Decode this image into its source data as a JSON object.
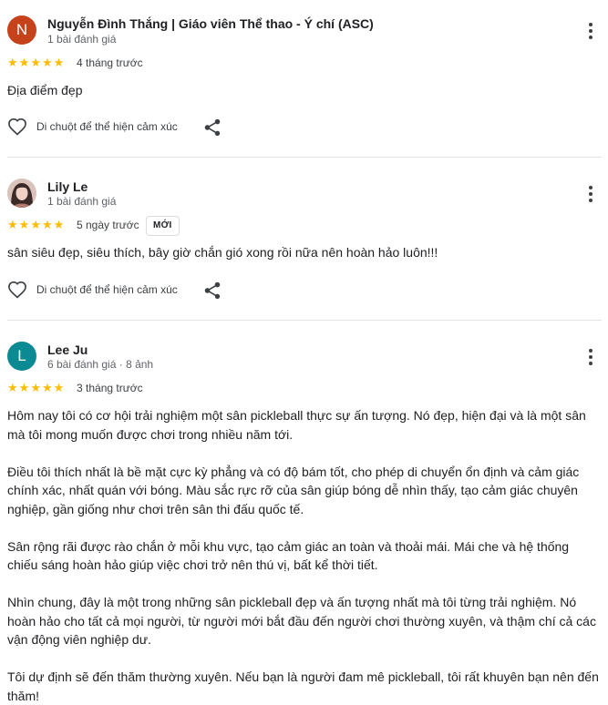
{
  "reviews": [
    {
      "avatar_letter": "N",
      "avatar_color": "#c5421a",
      "name": "Nguyễn Đình Thắng | Giáo viên Thể thao - Ý chí (ASC)",
      "meta": "1 bài đánh giá",
      "rating": 5,
      "time": "4 tháng trước",
      "badge": "",
      "paragraphs": [
        "Địa điểm đẹp"
      ],
      "react_label": "Di chuột để thể hiện cảm xúc"
    },
    {
      "avatar_letter": "",
      "avatar_color": "#6b4f4a",
      "name": "Lily Le",
      "meta": "1 bài đánh giá",
      "rating": 5,
      "time": "5 ngày trước",
      "badge": "MỚI",
      "paragraphs": [
        "sân siêu đẹp, siêu thích, bây giờ chắn gió xong rồi nữa nên hoàn hảo luôn!!!"
      ],
      "react_label": "Di chuột để thể hiện cảm xúc"
    },
    {
      "avatar_letter": "L",
      "avatar_color": "#0b8a94",
      "name": "Lee Ju",
      "meta": "6 bài đánh giá · 8 ảnh",
      "rating": 5,
      "time": "3 tháng trước",
      "badge": "",
      "paragraphs": [
        "Hôm nay tôi có cơ hội trải nghiệm một sân pickleball thực sự ấn tượng. Nó đẹp, hiện đại và là một sân mà tôi mong muốn được chơi trong nhiều năm tới.",
        "Điều tôi thích nhất là bề mặt cực kỳ phẳng và có độ bám tốt, cho phép di chuyển ổn định và cảm giác chính xác, nhất quán với bóng. Màu sắc rực rỡ của sân giúp bóng dễ nhìn thấy, tạo cảm giác chuyên nghiệp, gần giống như chơi trên sân thi đấu quốc tế.",
        "Sân rộng rãi được rào chắn ở mỗi khu vực, tạo cảm giác an toàn và thoải mái. Mái che và hệ thống chiếu sáng hoàn hảo giúp việc chơi trở nên thú vị, bất kể thời tiết.",
        "Nhìn chung, đây là một trong những sân pickleball đẹp và ấn tượng nhất mà tôi từng trải nghiệm. Nó hoàn hảo cho tất cả mọi người, từ người mới bắt đầu đến người chơi thường xuyên, và thậm chí cả các vận động viên nghiệp dư.",
        "Tôi dự định sẽ đến thăm thường xuyên. Nếu bạn là người đam mê pickleball, tôi rất khuyên bạn nên đến thăm!"
      ]
    }
  ],
  "colors": {
    "star": "#fbbc04",
    "divider": "#e3e3e3"
  },
  "icons": {
    "menu": "more-vert-icon",
    "react": "heart-outline-icon",
    "share": "share-icon"
  }
}
